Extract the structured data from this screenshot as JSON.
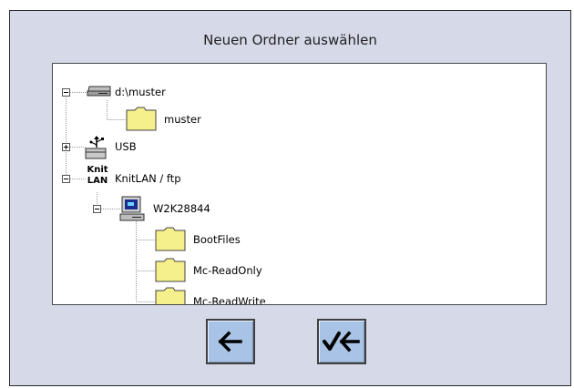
{
  "dialog": {
    "title": "Neuen Ordner auswählen"
  },
  "tree": {
    "items": [
      {
        "label": "d:\\muster",
        "icon": "drive-icon",
        "expanded": true
      },
      {
        "label": "muster",
        "icon": "folder-icon"
      },
      {
        "label": "USB",
        "icon": "usb-device-icon",
        "expanded": false
      },
      {
        "label": "KnitLAN / ftp",
        "icon": "knitlan-icon",
        "icon_text_top": "Knit",
        "icon_text_bottom": "LAN",
        "expanded": true
      },
      {
        "label": "W2K28844",
        "icon": "computer-icon",
        "expanded": true
      },
      {
        "label": "BootFiles",
        "icon": "folder-icon"
      },
      {
        "label": "Mc-ReadOnly",
        "icon": "folder-icon"
      },
      {
        "label": "Mc-ReadWrite",
        "icon": "folder-icon"
      }
    ]
  },
  "buttons": {
    "back_icon": "left-arrow-icon",
    "confirm_icon": "check-left-arrow-icon"
  },
  "colors": {
    "dialog_bg": "#d5d9e8",
    "button_bg": "#a9c3e6",
    "folder_fill": "#f5f08c"
  }
}
